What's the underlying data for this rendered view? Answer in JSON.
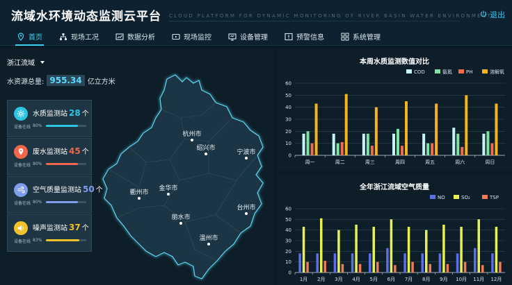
{
  "header": {
    "title": "流域水环境动态监测云平台",
    "subtitle": "CLOUD PLATFORM FOR DYNAMIC MONITORING OF RIVER BASIN WATER ENVIRONMENT",
    "logout_label": "退出"
  },
  "nav": [
    {
      "label": "首页",
      "icon": "location-pin-icon",
      "active": true
    },
    {
      "label": "现场工况",
      "icon": "hierarchy-icon",
      "active": false
    },
    {
      "label": "数据分析",
      "icon": "chart-window-icon",
      "active": false
    },
    {
      "label": "现场监控",
      "icon": "video-icon",
      "active": false
    },
    {
      "label": "设备管理",
      "icon": "device-icon",
      "active": false
    },
    {
      "label": "预警信息",
      "icon": "warning-icon",
      "active": false
    },
    {
      "label": "系统管理",
      "icon": "grid-icon",
      "active": false
    }
  ],
  "left": {
    "region": "浙江流域",
    "water_label": "水资源总量:",
    "water_value": "955.34",
    "water_unit": "亿立方米",
    "stations": [
      {
        "name": "水质监测站",
        "count": "28",
        "unit": "个",
        "label": "设备在线",
        "percent": "80%",
        "fill": 0.8,
        "color": "#2ec5e3",
        "icon": "gear-icon"
      },
      {
        "name": "废水监测站",
        "count": "45",
        "unit": "个",
        "label": "设备在线",
        "percent": "80%",
        "fill": 0.8,
        "color": "#f2674a",
        "icon": "map-marker-icon"
      },
      {
        "name": "空气质量监测站",
        "count": "50",
        "unit": "个",
        "label": "设备在线",
        "percent": "80%",
        "fill": 0.8,
        "color": "#7f9dec",
        "icon": "wind-icon"
      },
      {
        "name": "噪声监测站",
        "count": "37",
        "unit": "个",
        "label": "设备在线",
        "percent": "83%",
        "fill": 0.83,
        "color": "#f1c22a",
        "icon": "speaker-icon"
      }
    ],
    "cities": [
      "杭州市",
      "绍兴市",
      "宁波市",
      "衢州市",
      "金华市",
      "台州市",
      "丽水市",
      "温州市"
    ]
  },
  "chart_data": [
    {
      "type": "bar",
      "title": "本周水质监测数值对比",
      "categories": [
        "周一",
        "周二",
        "周三",
        "周四",
        "周五",
        "周六",
        "周日"
      ],
      "ylim": [
        0,
        60
      ],
      "yticks": [
        0,
        10,
        20,
        30,
        40,
        50,
        60
      ],
      "legend": "top-right",
      "grid": true,
      "series": [
        {
          "name": "COD",
          "color": "#c6f4f6",
          "values": [
            18,
            18,
            18,
            18,
            18,
            23,
            18
          ]
        },
        {
          "name": "氨氮",
          "color": "#7fe2a0",
          "values": [
            20,
            10,
            18,
            22,
            10,
            18,
            20
          ]
        },
        {
          "name": "PH",
          "color": "#f06c4e",
          "values": [
            10,
            11,
            8,
            8,
            10,
            7,
            10
          ]
        },
        {
          "name": "溶解氧",
          "color": "#f5b21a",
          "values": [
            43,
            51,
            40,
            45,
            43,
            50,
            43
          ]
        }
      ]
    },
    {
      "type": "bar",
      "title": "全年浙江流域空气质量",
      "categories": [
        "1月",
        "2月",
        "3月",
        "4月",
        "5月",
        "6月",
        "7月",
        "8月",
        "9月",
        "10月",
        "11月",
        "12月"
      ],
      "ylim": [
        0,
        60
      ],
      "yticks": [
        0,
        10,
        20,
        30,
        40,
        50,
        60
      ],
      "legend": "top-right",
      "grid": true,
      "series": [
        {
          "name": "NO",
          "color": "#5b6fe6",
          "values": [
            18,
            18,
            18,
            18,
            18,
            23,
            18,
            18,
            18,
            18,
            23,
            18
          ]
        },
        {
          "name": "SO₂",
          "color": "#e7f051",
          "values": [
            43,
            51,
            40,
            45,
            43,
            50,
            43,
            40,
            45,
            43,
            50,
            43
          ]
        },
        {
          "name": "TSP",
          "color": "#f07a56",
          "values": [
            10,
            11,
            8,
            8,
            10,
            7,
            10,
            8,
            8,
            10,
            7,
            10
          ]
        }
      ]
    }
  ]
}
